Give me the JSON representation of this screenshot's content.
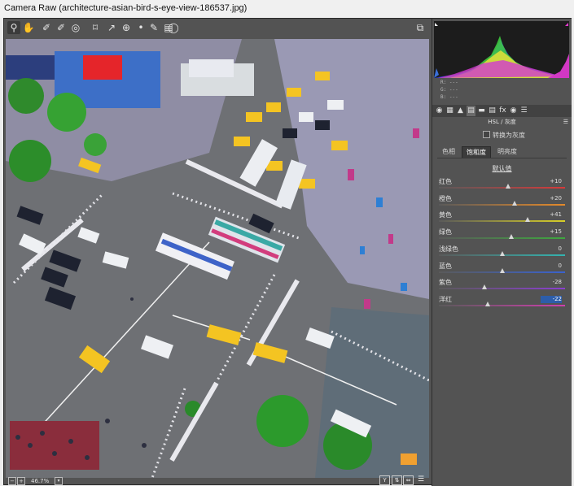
{
  "window": {
    "title": "Camera Raw (architecture-asian-bird-s-eye-view-186537.jpg)"
  },
  "toolbar": {
    "tools": [
      {
        "icon": "zoom-icon",
        "glyph": "⚲"
      },
      {
        "icon": "hand-icon",
        "glyph": "✋"
      },
      {
        "icon": "white-balance-icon",
        "glyph": "✐"
      },
      {
        "icon": "color-sampler-icon",
        "glyph": "✐"
      },
      {
        "icon": "target-adjust-icon",
        "glyph": "◎"
      },
      {
        "icon": "crop-icon",
        "glyph": "⌑"
      },
      {
        "icon": "straighten-icon",
        "glyph": "↗"
      },
      {
        "icon": "spot-removal-icon",
        "glyph": "⊕"
      },
      {
        "icon": "red-eye-icon",
        "glyph": "•"
      },
      {
        "icon": "adjustment-brush-icon",
        "glyph": "✎"
      },
      {
        "icon": "graduated-filter-icon",
        "glyph": "▤"
      },
      {
        "icon": "radial-filter-icon",
        "glyph": "◯"
      }
    ],
    "fullscreen_icon": "fullscreen-icon"
  },
  "status": {
    "zoom": "46.7%"
  },
  "histogram": {
    "rgb_labels": [
      "R:",
      "G:",
      "B:"
    ],
    "rgb_values": [
      "---",
      "---",
      "---"
    ]
  },
  "panel": {
    "title": "HSL / 灰度",
    "grayscale_label": "转换为灰度",
    "tabs": [
      "色相",
      "饱和度",
      "明亮度"
    ],
    "selected_tab": 1,
    "default_link": "默认值",
    "sliders": [
      {
        "label": "红色",
        "value": "+10",
        "pct": 0.55,
        "color": "#d63a3a"
      },
      {
        "label": "橙色",
        "value": "+20",
        "pct": 0.6,
        "color": "#e58a2a"
      },
      {
        "label": "黄色",
        "value": "+41",
        "pct": 0.705,
        "color": "#d8cf27"
      },
      {
        "label": "绿色",
        "value": "+15",
        "pct": 0.575,
        "color": "#3ea83e"
      },
      {
        "label": "浅绿色",
        "value": "0",
        "pct": 0.5,
        "color": "#33b4b0"
      },
      {
        "label": "蓝色",
        "value": "0",
        "pct": 0.5,
        "color": "#3a62cf"
      },
      {
        "label": "紫色",
        "value": "-28",
        "pct": 0.36,
        "color": "#8a3fd0"
      },
      {
        "label": "洋红",
        "value": "-22",
        "pct": 0.39,
        "color": "#cf3fae",
        "highlight": true
      }
    ]
  },
  "colors": {
    "accent_selected": "#2d5daa",
    "panel_bg": "#535353"
  }
}
